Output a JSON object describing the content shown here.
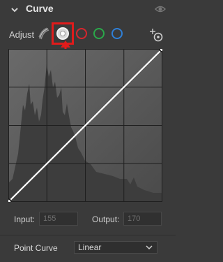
{
  "header": {
    "title": "Curve",
    "collapse_icon": "chevron-down-icon",
    "visibility_icon": "eye-icon"
  },
  "adjust": {
    "label": "Adjust",
    "modes": [
      {
        "name": "parametric",
        "icon": "brush-stroke-icon"
      },
      {
        "name": "point",
        "icon": "point-curve-icon",
        "selected": true
      },
      {
        "name": "red",
        "color": "#d8262e"
      },
      {
        "name": "green",
        "color": "#2aa84a"
      },
      {
        "name": "blue",
        "color": "#2f7fd6"
      }
    ],
    "target_icon": "targeted-adjustment-icon",
    "highlight_color": "#e11b1b"
  },
  "curve": {
    "points": [
      [
        0,
        0
      ],
      [
        255,
        255
      ]
    ]
  },
  "input": {
    "label": "Input:",
    "value": "155"
  },
  "output": {
    "label": "Output:",
    "value": "170"
  },
  "point_curve": {
    "label": "Point Curve",
    "selected": "Linear"
  }
}
